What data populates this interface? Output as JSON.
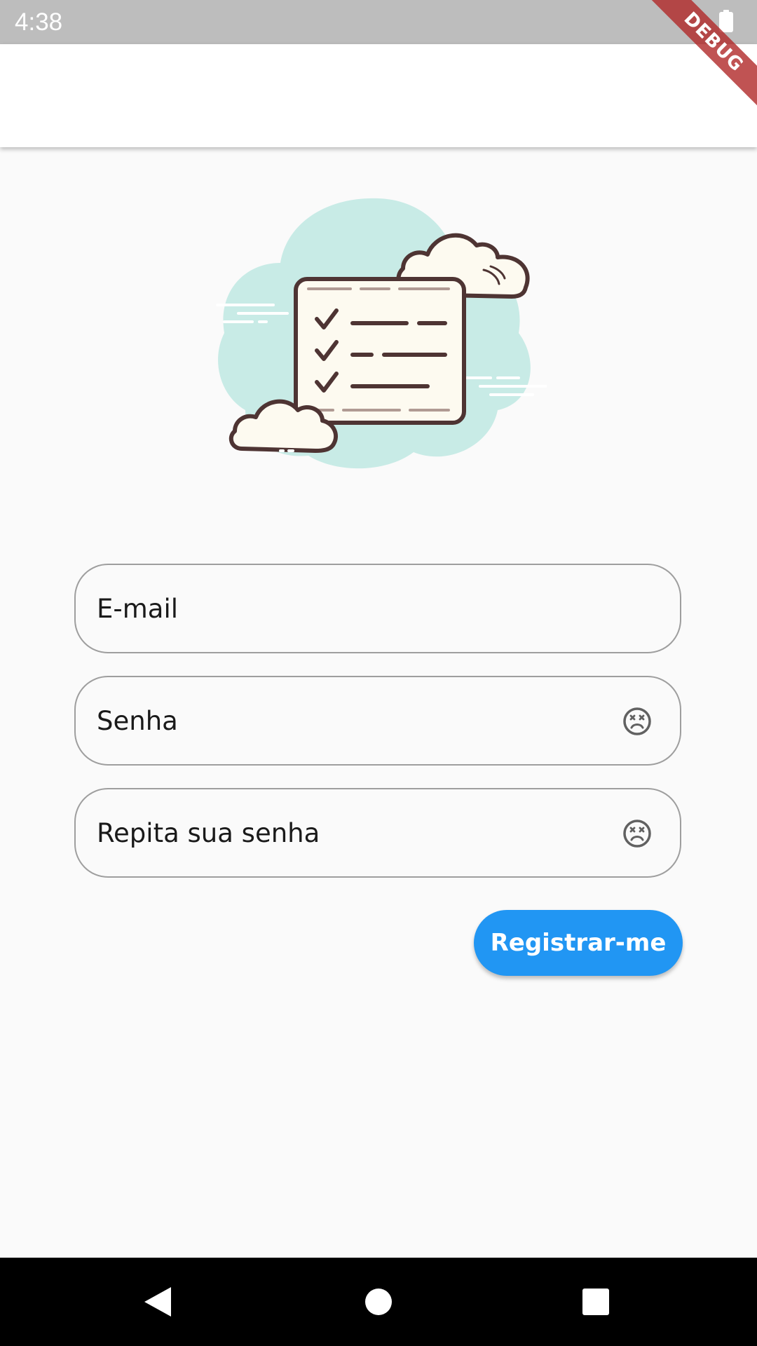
{
  "status_bar": {
    "time": "4:38",
    "battery_icon": "battery-full-icon"
  },
  "debug_banner": {
    "label": "DEBUG"
  },
  "illustration": {
    "icon": "checklist-clouds-illustration"
  },
  "form": {
    "email": {
      "placeholder": "E-mail"
    },
    "password": {
      "placeholder": "Senha",
      "toggle_icon": "visibility-toggle-icon"
    },
    "repeat_password": {
      "placeholder": "Repita sua senha",
      "toggle_icon": "visibility-toggle-icon"
    },
    "register_label": "Registrar-me"
  },
  "colors": {
    "accent": "#2196f3",
    "status_bar": "#bdbdbd",
    "background": "#fafafa",
    "field_border": "#9e9e9e"
  },
  "nav_bar": {
    "back_icon": "back-triangle-icon",
    "home_icon": "home-circle-icon",
    "recent_icon": "recent-square-icon"
  }
}
